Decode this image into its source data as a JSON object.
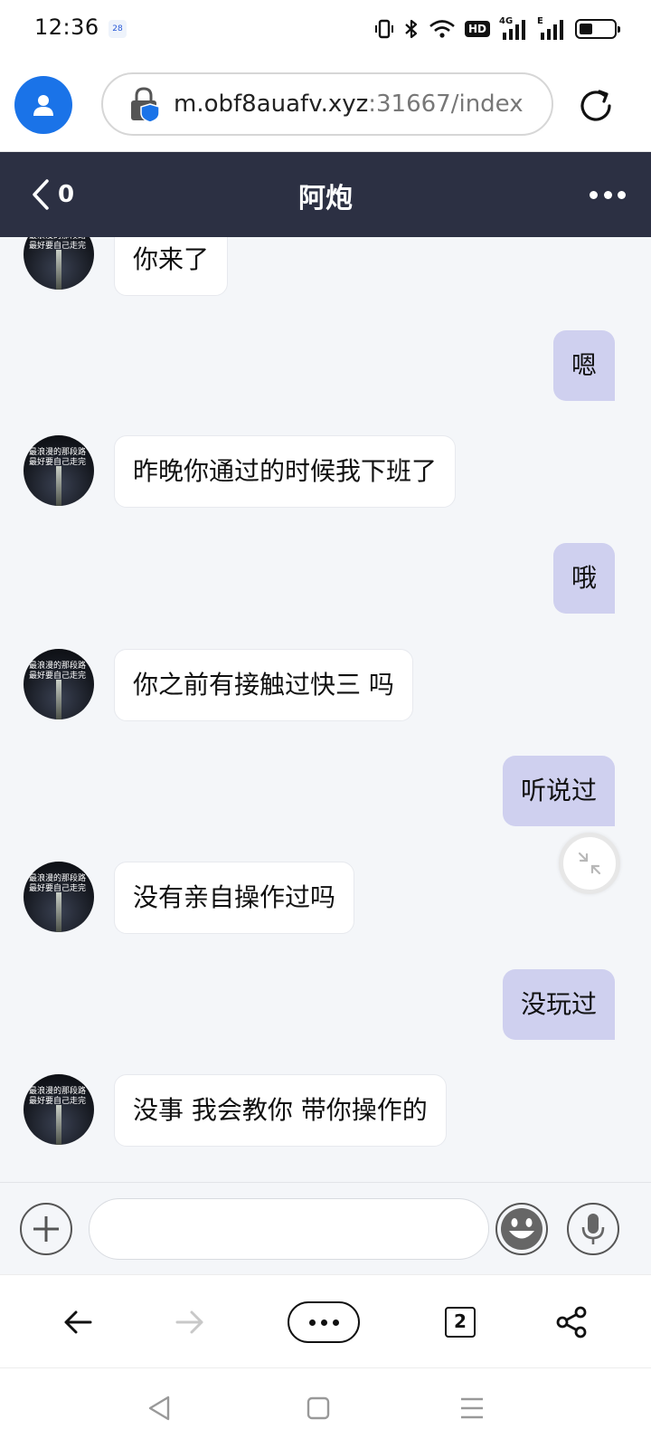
{
  "status_bar": {
    "time": "12:36",
    "notification_badge": "28",
    "hd_label": "HD",
    "network_label": "4G",
    "network_label_2": "E",
    "battery_percent": 40
  },
  "browser": {
    "url_host": "m.obf8auafv.xyz",
    "url_rest": ":31667/index"
  },
  "chat": {
    "back_count": "0",
    "title": "阿炮",
    "avatar_text": "最浪漫的那段路 最好要自己走完",
    "messages": [
      {
        "side": "in",
        "text": "你来了"
      },
      {
        "side": "out",
        "text": "嗯"
      },
      {
        "side": "in",
        "text": "昨晚你通过的时候我下班了"
      },
      {
        "side": "out",
        "text": "哦"
      },
      {
        "side": "in",
        "text": "你之前有接触过快三 吗"
      },
      {
        "side": "out",
        "text": "听说过"
      },
      {
        "side": "in",
        "text": "没有亲自操作过吗"
      },
      {
        "side": "out",
        "text": "没玩过"
      },
      {
        "side": "in",
        "text": "没事 我会教你 带你操作的"
      }
    ]
  },
  "input": {
    "value": "",
    "placeholder": ""
  },
  "bottom_nav": {
    "tabs_count": "2"
  },
  "icons": {
    "back": "chevron-left-icon",
    "more": "more-dots-icon",
    "add": "plus-icon",
    "emoji": "emoji-icon",
    "voice": "microphone-icon",
    "refresh": "refresh-icon",
    "share": "share-icon",
    "lock": "lock-shield-icon",
    "profile": "profile-icon",
    "minimize": "minimize-icon"
  },
  "colors": {
    "header_bg": "#2c3043",
    "outgoing_bubble": "#cfd0ef",
    "incoming_bubble": "#ffffff",
    "chat_bg": "#f4f6f9",
    "profile_blue": "#1a73e8"
  }
}
